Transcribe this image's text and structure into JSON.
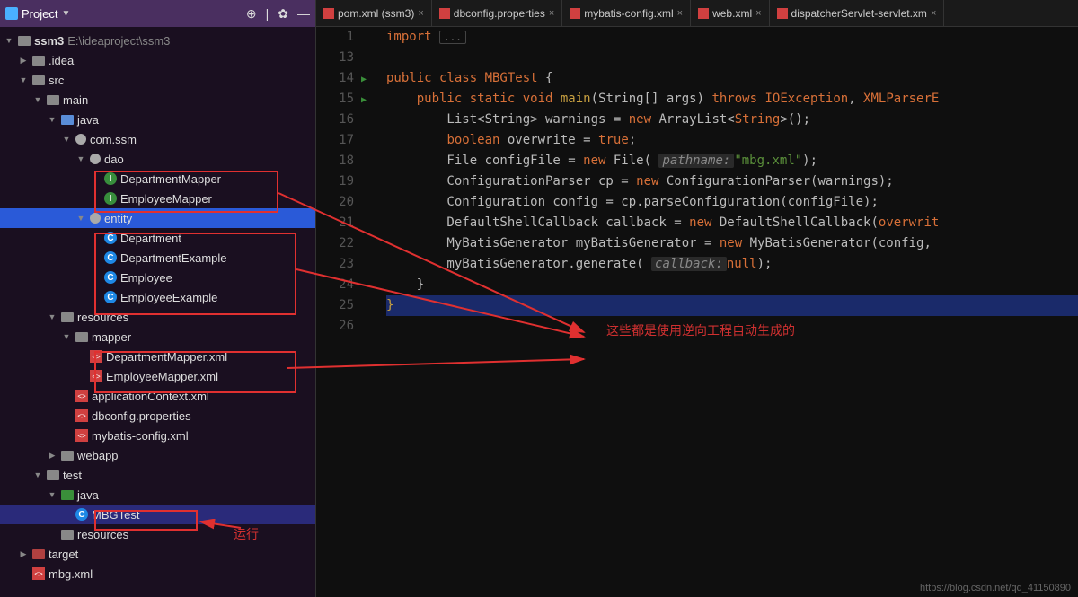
{
  "sidebar": {
    "title": "Project",
    "root": "ssm3",
    "root_path": "E:\\ideaproject\\ssm3",
    "tree": [
      {
        "depth": 1,
        "arrow": "collapsed",
        "icon": "folder",
        "label": ".idea"
      },
      {
        "depth": 1,
        "arrow": "expanded",
        "icon": "folder",
        "label": "src"
      },
      {
        "depth": 2,
        "arrow": "expanded",
        "icon": "folder",
        "label": "main"
      },
      {
        "depth": 3,
        "arrow": "expanded",
        "icon": "folder-blue",
        "label": "java"
      },
      {
        "depth": 4,
        "arrow": "expanded",
        "icon": "package",
        "label": "com.ssm"
      },
      {
        "depth": 5,
        "arrow": "expanded",
        "icon": "package",
        "label": "dao"
      },
      {
        "depth": 6,
        "arrow": "",
        "icon": "interface",
        "label": "DepartmentMapper"
      },
      {
        "depth": 6,
        "arrow": "",
        "icon": "interface",
        "label": "EmployeeMapper"
      },
      {
        "depth": 5,
        "arrow": "expanded",
        "icon": "package",
        "label": "entity",
        "selected": true
      },
      {
        "depth": 6,
        "arrow": "",
        "icon": "class",
        "label": "Department"
      },
      {
        "depth": 6,
        "arrow": "",
        "icon": "class",
        "label": "DepartmentExample"
      },
      {
        "depth": 6,
        "arrow": "",
        "icon": "class",
        "label": "Employee"
      },
      {
        "depth": 6,
        "arrow": "",
        "icon": "class",
        "label": "EmployeeExample"
      },
      {
        "depth": 3,
        "arrow": "expanded",
        "icon": "folder",
        "label": "resources"
      },
      {
        "depth": 4,
        "arrow": "expanded",
        "icon": "folder",
        "label": "mapper"
      },
      {
        "depth": 5,
        "arrow": "",
        "icon": "xml",
        "label": "DepartmentMapper.xml"
      },
      {
        "depth": 5,
        "arrow": "",
        "icon": "xml",
        "label": "EmployeeMapper.xml"
      },
      {
        "depth": 4,
        "arrow": "",
        "icon": "xml",
        "label": "applicationContext.xml"
      },
      {
        "depth": 4,
        "arrow": "",
        "icon": "xml",
        "label": "dbconfig.properties"
      },
      {
        "depth": 4,
        "arrow": "",
        "icon": "xml",
        "label": "mybatis-config.xml"
      },
      {
        "depth": 3,
        "arrow": "collapsed",
        "icon": "folder",
        "label": "webapp"
      },
      {
        "depth": 2,
        "arrow": "expanded",
        "icon": "folder",
        "label": "test"
      },
      {
        "depth": 3,
        "arrow": "expanded",
        "icon": "folder-green",
        "label": "java"
      },
      {
        "depth": 4,
        "arrow": "",
        "icon": "class",
        "label": "MBGTest",
        "selectedRow": true
      },
      {
        "depth": 3,
        "arrow": "",
        "icon": "folder",
        "label": "resources"
      },
      {
        "depth": 1,
        "arrow": "collapsed",
        "icon": "folder-red",
        "label": "target"
      },
      {
        "depth": 1,
        "arrow": "",
        "icon": "xml",
        "label": "mbg.xml"
      }
    ]
  },
  "tabs": [
    {
      "icon": "m",
      "label": "pom.xml (ssm3)"
    },
    {
      "icon": "x",
      "label": "dbconfig.properties"
    },
    {
      "icon": "x",
      "label": "mybatis-config.xml"
    },
    {
      "icon": "x",
      "label": "web.xml"
    },
    {
      "icon": "x",
      "label": "dispatcherServlet-servlet.xm"
    }
  ],
  "code": {
    "start_line": 1,
    "lines": [
      {
        "n": 1,
        "tokens": [
          {
            "t": "kw",
            "v": "import "
          },
          {
            "t": "fold",
            "v": "..."
          }
        ]
      },
      {
        "n": 13,
        "tokens": []
      },
      {
        "n": 14,
        "run": true,
        "tokens": [
          {
            "t": "kw",
            "v": "public class "
          },
          {
            "t": "type",
            "v": "MBGTest"
          },
          {
            "t": "var",
            "v": " {"
          }
        ]
      },
      {
        "n": 15,
        "run": true,
        "tokens": [
          {
            "t": "var",
            "v": "    "
          },
          {
            "t": "kw",
            "v": "public static void "
          },
          {
            "t": "method",
            "v": "main"
          },
          {
            "t": "var",
            "v": "(String[] args) "
          },
          {
            "t": "kw",
            "v": "throws "
          },
          {
            "t": "type",
            "v": "IOException"
          },
          {
            "t": "var",
            "v": ", "
          },
          {
            "t": "type",
            "v": "XMLParserE"
          }
        ]
      },
      {
        "n": 16,
        "tokens": [
          {
            "t": "var",
            "v": "        List<String> warnings = "
          },
          {
            "t": "kw",
            "v": "new "
          },
          {
            "t": "var",
            "v": "ArrayList<"
          },
          {
            "t": "type",
            "v": "String"
          },
          {
            "t": "var",
            "v": ">();"
          }
        ]
      },
      {
        "n": 17,
        "tokens": [
          {
            "t": "var",
            "v": "        "
          },
          {
            "t": "kw",
            "v": "boolean "
          },
          {
            "t": "var",
            "v": "overwrite = "
          },
          {
            "t": "kw",
            "v": "true"
          },
          {
            "t": "var",
            "v": ";"
          }
        ]
      },
      {
        "n": 18,
        "tokens": [
          {
            "t": "var",
            "v": "        File configFile = "
          },
          {
            "t": "kw",
            "v": "new "
          },
          {
            "t": "var",
            "v": "File( "
          },
          {
            "t": "param",
            "v": "pathname:"
          },
          {
            "t": "str",
            "v": "\"mbg.xml\""
          },
          {
            "t": "var",
            "v": ");"
          }
        ]
      },
      {
        "n": 19,
        "tokens": [
          {
            "t": "var",
            "v": "        ConfigurationParser cp = "
          },
          {
            "t": "kw",
            "v": "new "
          },
          {
            "t": "var",
            "v": "ConfigurationParser(warnings);"
          }
        ]
      },
      {
        "n": 20,
        "tokens": [
          {
            "t": "var",
            "v": "        Configuration config = cp.parseConfiguration(configFile);"
          }
        ]
      },
      {
        "n": 21,
        "tokens": [
          {
            "t": "var",
            "v": "        DefaultShellCallback callback = "
          },
          {
            "t": "kw",
            "v": "new "
          },
          {
            "t": "var",
            "v": "DefaultShellCallback("
          },
          {
            "t": "type",
            "v": "overwrit"
          }
        ]
      },
      {
        "n": 22,
        "tokens": [
          {
            "t": "var",
            "v": "        MyBatisGenerator myBatisGenerator = "
          },
          {
            "t": "kw",
            "v": "new "
          },
          {
            "t": "var",
            "v": "MyBatisGenerator(config, "
          }
        ]
      },
      {
        "n": 23,
        "tokens": [
          {
            "t": "var",
            "v": "        myBatisGenerator.generate( "
          },
          {
            "t": "param",
            "v": "callback:"
          },
          {
            "t": "kw",
            "v": "null"
          },
          {
            "t": "var",
            "v": ");"
          }
        ]
      },
      {
        "n": 24,
        "tokens": [
          {
            "t": "var",
            "v": "    }"
          }
        ]
      },
      {
        "n": 25,
        "hl": true,
        "tokens": [
          {
            "t": "method",
            "v": "}"
          }
        ]
      },
      {
        "n": 26,
        "tokens": []
      }
    ]
  },
  "annotations": {
    "main": "这些都是使用逆向工程自动生成的",
    "run": "运行"
  },
  "watermark": "https://blog.csdn.net/qq_41150890"
}
